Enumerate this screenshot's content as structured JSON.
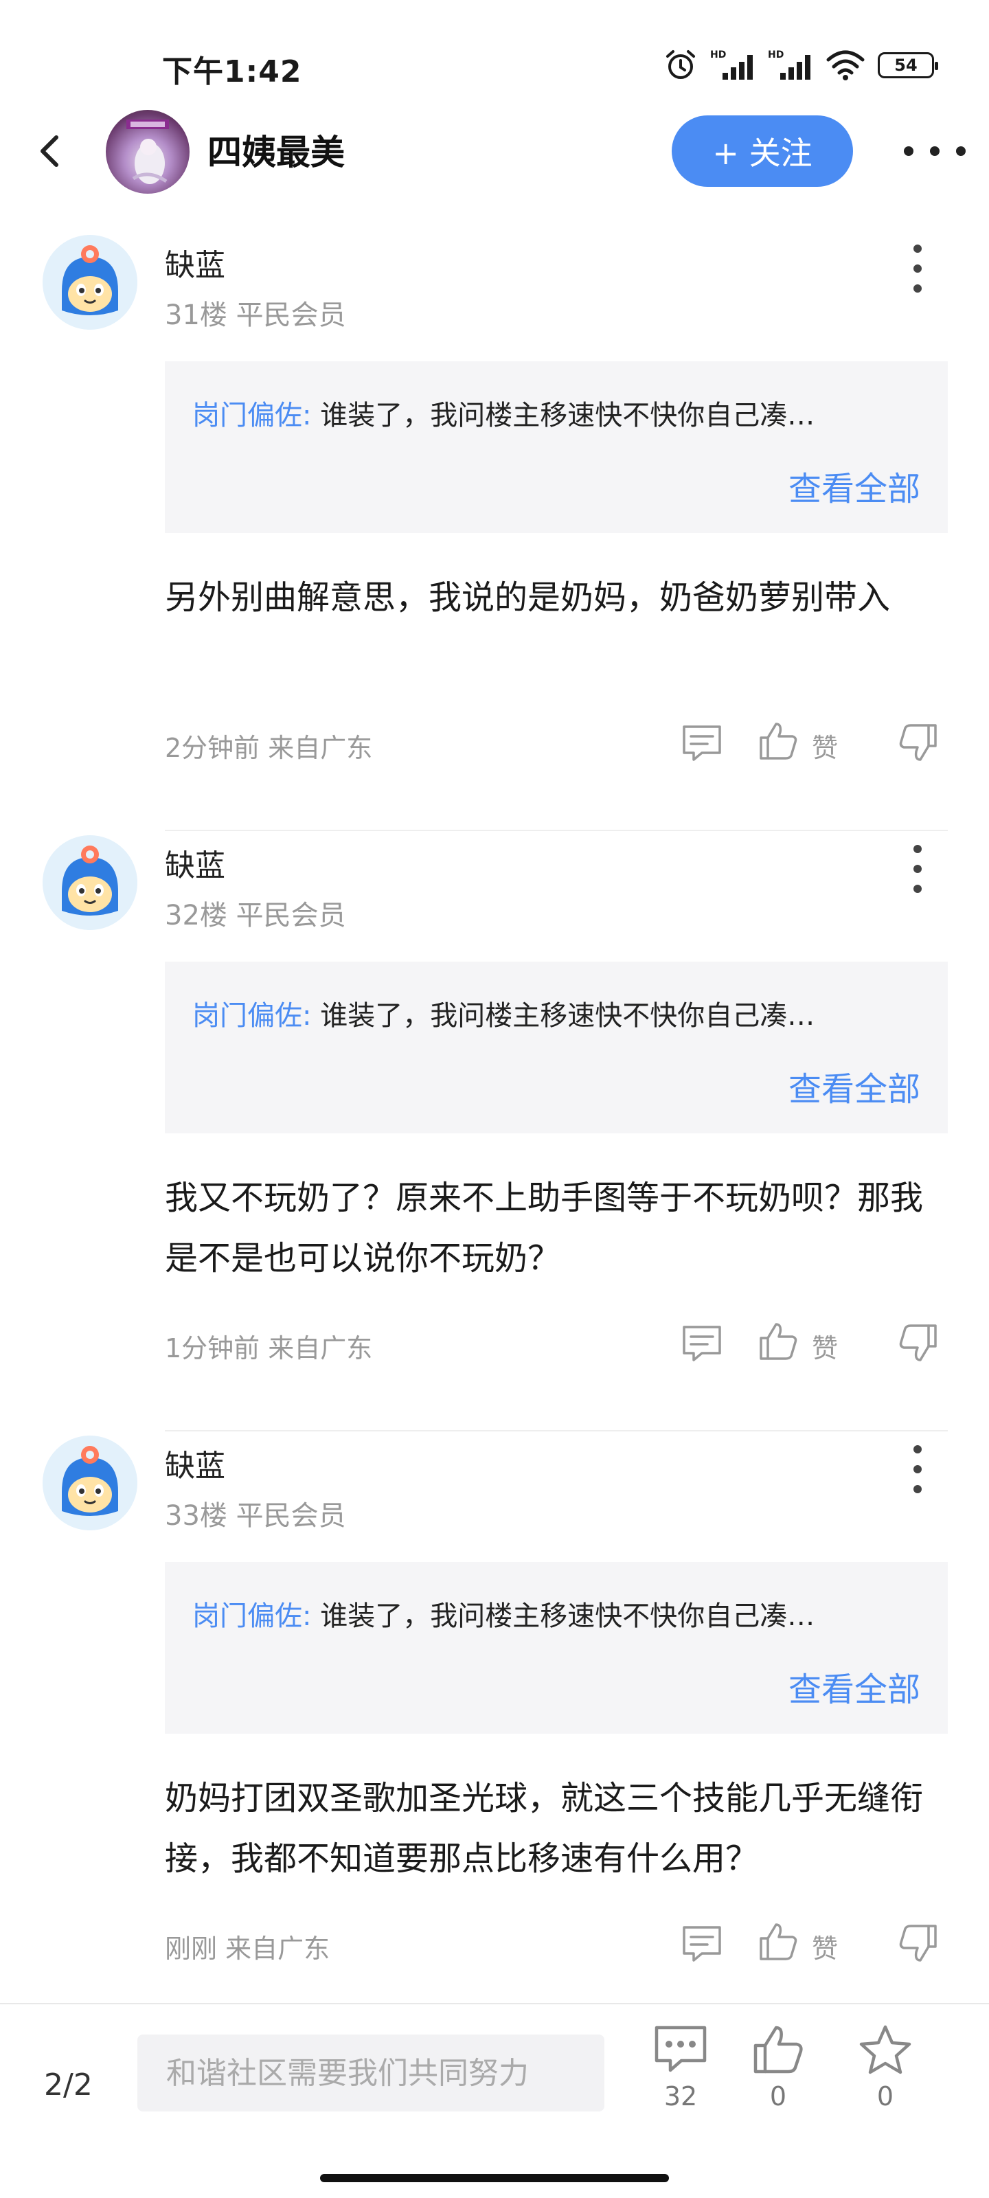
{
  "status_bar": {
    "time": "下午1:42",
    "battery": "54",
    "signal_label_1": "HD",
    "signal_label_2": "HD"
  },
  "header": {
    "forum_name": "四姨最美",
    "follow_label": "+ 关注",
    "back_icon": "chevron-left-icon",
    "more_icon": "more-dots-icon"
  },
  "posts": [
    {
      "username": "缺蓝",
      "floor": "31楼",
      "rank": "平民会员",
      "quote_author": "岗门偏佐:",
      "quote_text": "谁装了，我问楼主移速快不快你自己凑…",
      "view_all": "查看全部",
      "body": "另外别曲解意思，我说的是奶妈，奶爸奶萝别带入",
      "time_location": "2分钟前 来自广东",
      "like_label": "赞"
    },
    {
      "username": "缺蓝",
      "floor": "32楼",
      "rank": "平民会员",
      "quote_author": "岗门偏佐:",
      "quote_text": "谁装了，我问楼主移速快不快你自己凑…",
      "view_all": "查看全部",
      "body": "我又不玩奶了？原来不上助手图等于不玩奶呗？那我是不是也可以说你不玩奶？",
      "time_location": "1分钟前 来自广东",
      "like_label": "赞"
    },
    {
      "username": "缺蓝",
      "floor": "33楼",
      "rank": "平民会员",
      "quote_author": "岗门偏佐:",
      "quote_text": "谁装了，我问楼主移速快不快你自己凑…",
      "view_all": "查看全部",
      "body": "奶妈打团双圣歌加圣光球，就这三个技能几乎无缝衔接，我都不知道要那点比移速有什么用？",
      "time_location": "刚刚 来自广东",
      "like_label": "赞"
    }
  ],
  "bottom_bar": {
    "page": "2/2",
    "input_placeholder": "和谐社区需要我们共同努力",
    "comment_count": "32",
    "like_count": "0",
    "favorite_count": "0"
  },
  "colors": {
    "accent": "#4b8cf3",
    "meta_text": "#999999",
    "quote_bg": "#f5f5f7"
  }
}
